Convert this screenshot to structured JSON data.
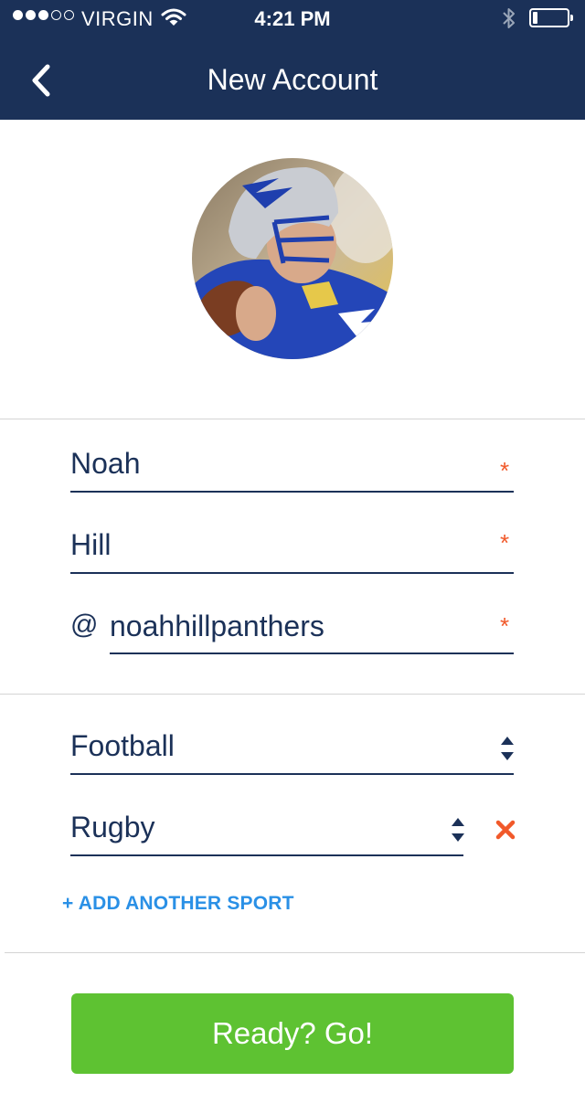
{
  "status_bar": {
    "carrier": "VIRGIN",
    "time": "4:21 PM",
    "signal_bars_filled": 3,
    "signal_bars_total": 5,
    "battery_level": 0.15
  },
  "nav": {
    "title": "New Account",
    "back_icon": "chevron-left-icon"
  },
  "profile": {
    "avatar": "football-player-photo"
  },
  "form": {
    "first_name": "Noah",
    "last_name": "Hill",
    "username_prefix": "@",
    "username": "noahhillpanthers",
    "required_marker": "*"
  },
  "sports": {
    "items": [
      {
        "label": "Football"
      },
      {
        "label": "Rugby"
      }
    ],
    "add_label": "+ ADD ANOTHER SPORT"
  },
  "submit": {
    "label": "Ready? Go!"
  },
  "colors": {
    "nav_bg": "#1b3158",
    "text": "#1b3158",
    "required": "#f1592a",
    "link": "#2a90e6",
    "button": "#5ec232"
  }
}
